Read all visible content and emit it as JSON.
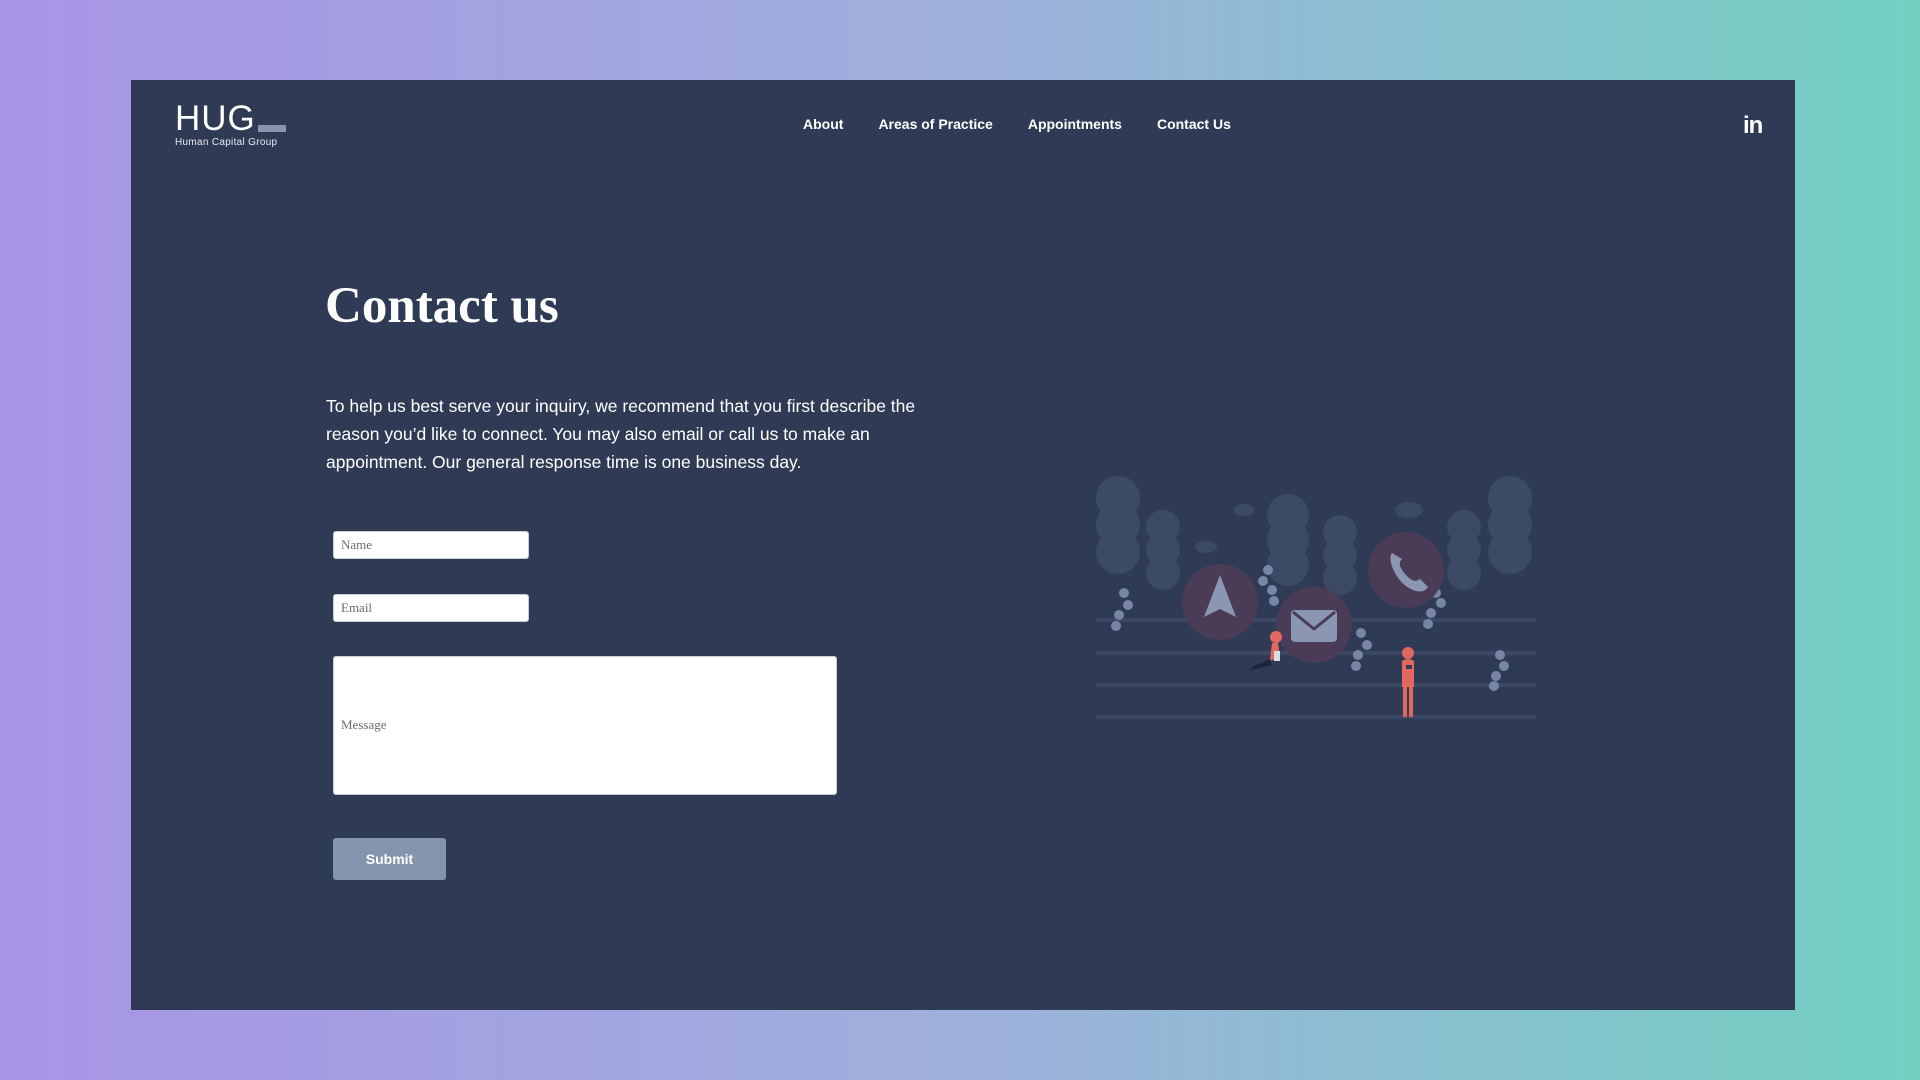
{
  "header": {
    "logo_text": "HUG",
    "logo_subtitle": "Human Capital Group",
    "nav": [
      {
        "label": "About"
      },
      {
        "label": "Areas of Practice"
      },
      {
        "label": "Appointments"
      },
      {
        "label": "Contact Us"
      }
    ],
    "social_icon": "linkedin-icon",
    "social_label": "in"
  },
  "main": {
    "title": "Contact us",
    "description": "To help us best serve your inquiry, we recommend that you first describe the reason you’d like to connect. You may also email or call us to make an appointment. Our general response time is one business day.",
    "form": {
      "name_placeholder": "Name",
      "email_placeholder": "Email",
      "message_placeholder": "Message",
      "submit_label": "Submit"
    },
    "illustration_icons": [
      "navigation-icon",
      "mail-icon",
      "phone-icon"
    ]
  },
  "colors": {
    "page_background": "#2f3a55",
    "submit_button": "#8594ad",
    "accent_figure": "#e3685d",
    "gradient_left": "#a894e6",
    "gradient_right": "#72d0c1"
  }
}
